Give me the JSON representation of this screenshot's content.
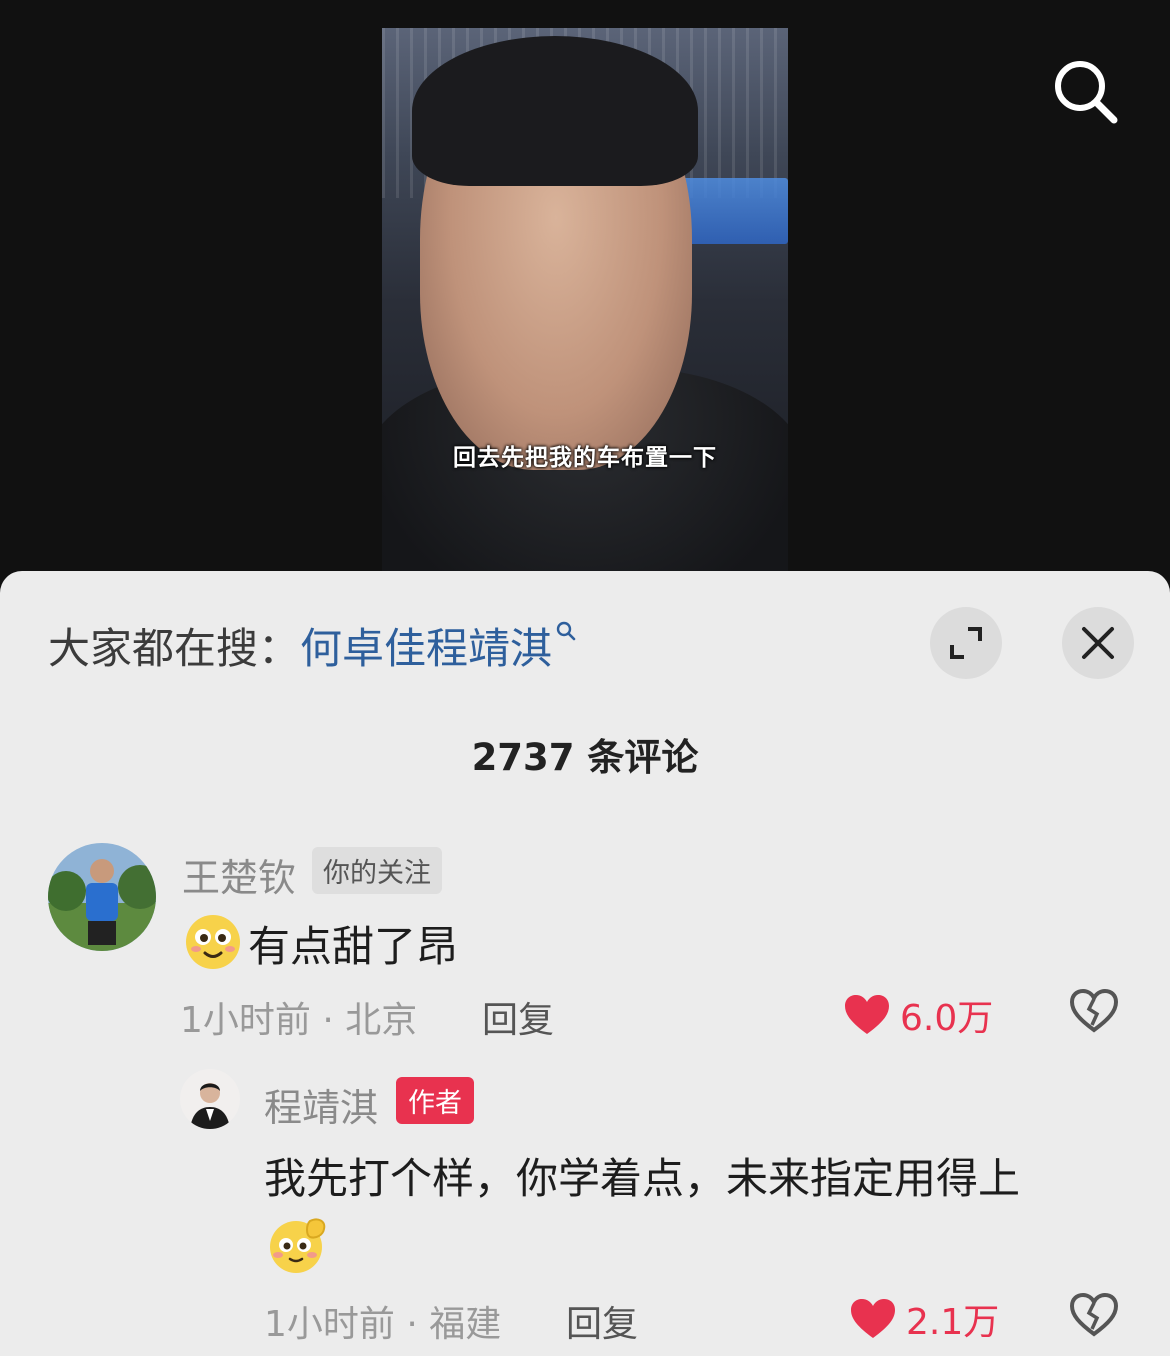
{
  "video": {
    "subtitle": "回去先把我的车布置一下"
  },
  "header": {
    "search_icon": "search-icon"
  },
  "panel": {
    "trend_prefix": "大家都在搜：",
    "trend_query": "何卓佳程靖淇",
    "trend_icon": "search-small-icon",
    "expand_icon": "expand-icon",
    "close_icon": "close-icon",
    "comment_count": "2737 条评论"
  },
  "comments": [
    {
      "username": "王楚钦",
      "badge": "你的关注",
      "text": "有点甜了昂",
      "emoji": "blushing-smile-emoji",
      "time_location": "1小时前 · 北京",
      "reply_label": "回复",
      "likes": "6.0万",
      "like_color": "#e8324f",
      "replies": [
        {
          "username": "程靖淇",
          "badge": "作者",
          "text": "我先打个样，你学着点，未来指定用得上",
          "emoji": "shy-hand-emoji",
          "time_location": "1小时前 · 福建",
          "reply_label": "回复",
          "likes": "2.1万"
        }
      ]
    }
  ]
}
